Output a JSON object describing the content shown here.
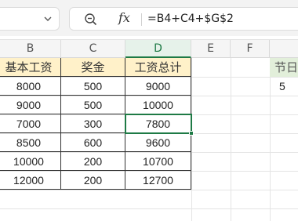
{
  "formula_bar": {
    "formula": "=B4+C4+$G$2"
  },
  "columns": [
    "B",
    "C",
    "D",
    "E",
    "F"
  ],
  "table": {
    "headers": [
      "基本工资",
      "奖金",
      "工资总计"
    ],
    "rows": [
      [
        "8000",
        "500",
        "9000"
      ],
      [
        "9000",
        "500",
        "10000"
      ],
      [
        "7000",
        "300",
        "7800"
      ],
      [
        "8500",
        "600",
        "9600"
      ],
      [
        "10000",
        "200",
        "10700"
      ],
      [
        "12000",
        "200",
        "12700"
      ]
    ]
  },
  "side": {
    "header": "节日",
    "value": "5"
  },
  "colors": {
    "header_fill": "#fff1c9",
    "side_header_fill": "#e2efda",
    "selection": "#1e7a45"
  }
}
